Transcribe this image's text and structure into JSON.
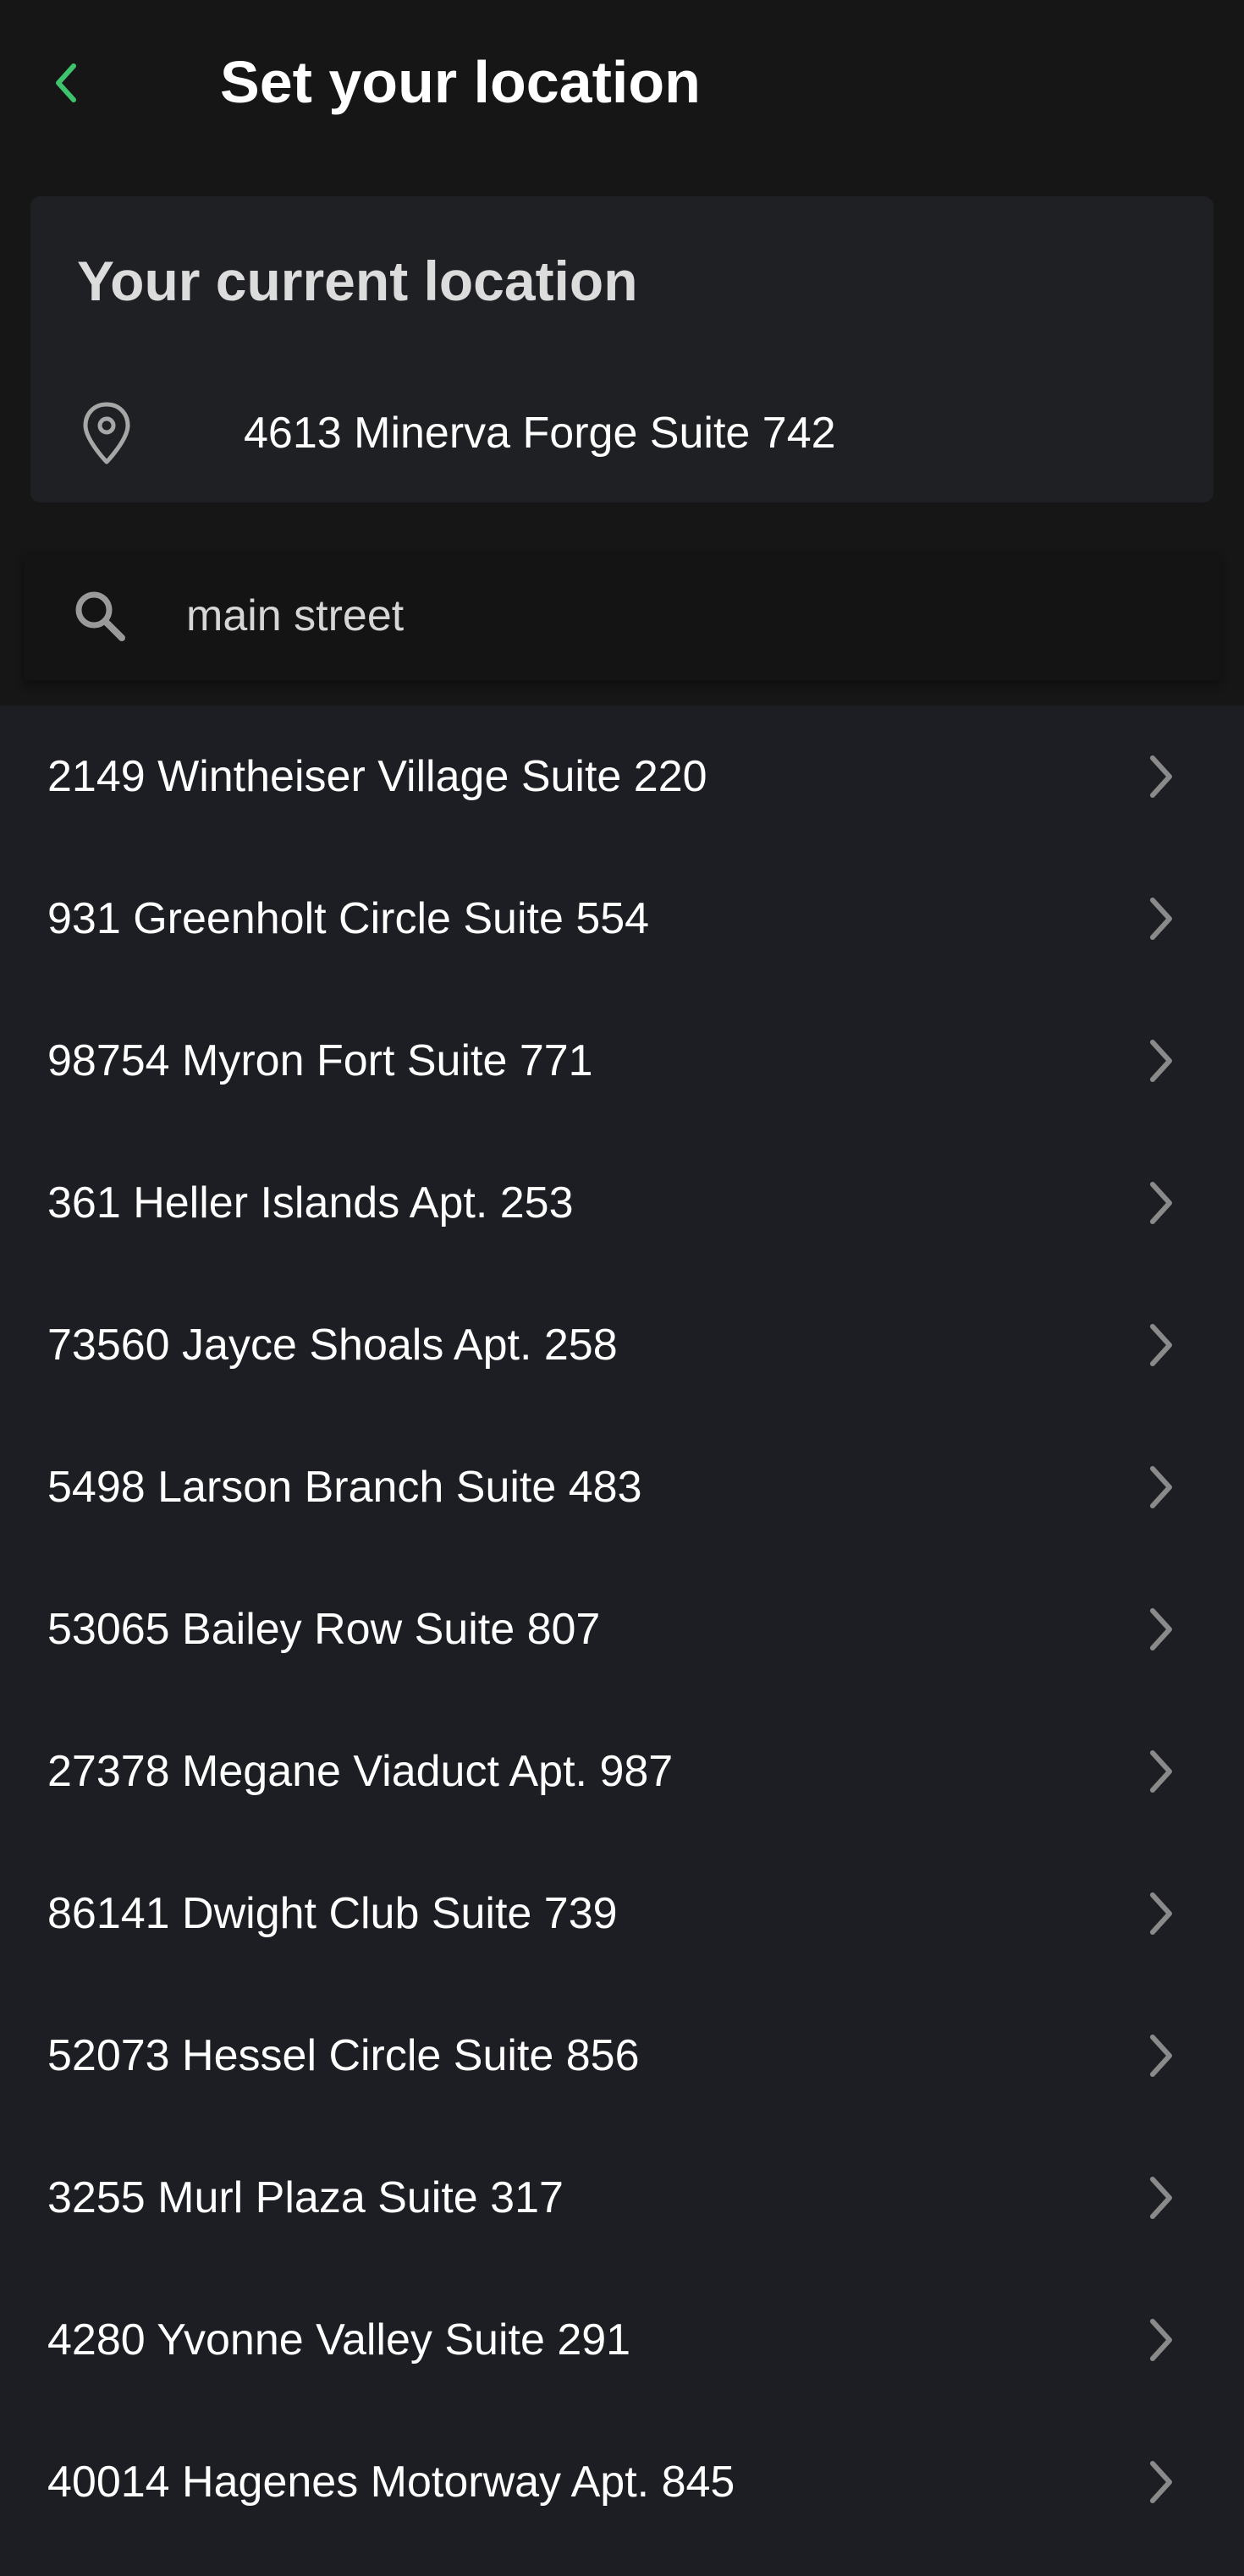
{
  "header": {
    "title": "Set your location",
    "back_icon": "chevron-left-icon",
    "accent_color": "#3ec46d"
  },
  "current_location": {
    "heading": "Your current location",
    "address": "4613 Minerva Forge Suite 742",
    "icon": "map-pin-icon"
  },
  "search": {
    "value": "main street",
    "icon": "search-icon"
  },
  "results": [
    "2149 Wintheiser Village Suite 220",
    "931 Greenholt Circle Suite 554",
    "98754 Myron Fort Suite 771",
    "361 Heller Islands Apt. 253",
    "73560 Jayce Shoals Apt. 258",
    "5498 Larson Branch Suite 483",
    "53065 Bailey Row Suite 807",
    "27378 Megane Viaduct Apt. 987",
    "86141 Dwight Club Suite 739",
    "52073 Hessel Circle Suite 856",
    "3255 Murl Plaza Suite 317",
    "4280 Yvonne Valley Suite 291",
    "40014 Hagenes Motorway Apt. 845"
  ]
}
